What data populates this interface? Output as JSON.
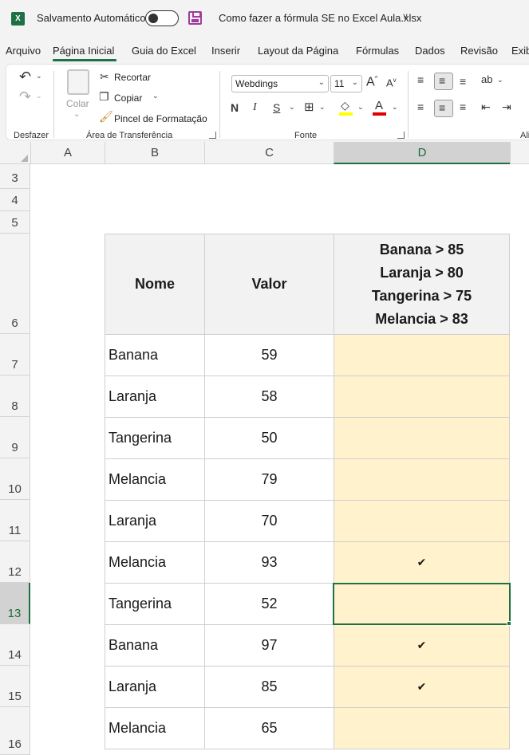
{
  "titlebar": {
    "app_logo": "X",
    "autosave_label": "Salvamento Automático",
    "doc_title": "Como fazer a fórmula SE no Excel Aula.xlsx",
    "dropdown_glyph": "∨"
  },
  "tabs": [
    "Arquivo",
    "Página Inicial",
    "Guia do Excel",
    "Inserir",
    "Layout da Página",
    "Fórmulas",
    "Dados",
    "Revisão",
    "Exib"
  ],
  "ribbon": {
    "undo_group_label": "Desfazer",
    "clipboard": {
      "paste_label": "Colar",
      "cut_label": "Recortar",
      "copy_label": "Copiar",
      "format_painter_label": "Pincel de Formatação",
      "group_label": "Área de Transferência"
    },
    "font": {
      "font_name": "Webdings",
      "font_size": "11",
      "bold": "N",
      "italic": "I",
      "underline": "S",
      "grow": "A",
      "shrink": "A",
      "font_color_letter": "A",
      "group_label": "Fonte"
    },
    "alignment": {
      "group_label": "Ali"
    }
  },
  "columns": [
    "A",
    "B",
    "C",
    "D"
  ],
  "rows": [
    "3",
    "4",
    "5",
    "6",
    "7",
    "8",
    "9",
    "10",
    "11",
    "12",
    "13",
    "14",
    "15",
    "16"
  ],
  "selected": {
    "column": "D",
    "row": "13"
  },
  "table": {
    "header_nome": "Nome",
    "header_valor": "Valor",
    "criteria": [
      "Banana > 85",
      "Laranja > 80",
      "Tangerina > 75",
      "Melancia > 83"
    ],
    "rows": [
      {
        "nome": "Banana",
        "valor": "59",
        "resultado": ""
      },
      {
        "nome": "Laranja",
        "valor": "58",
        "resultado": ""
      },
      {
        "nome": "Tangerina",
        "valor": "50",
        "resultado": ""
      },
      {
        "nome": "Melancia",
        "valor": "79",
        "resultado": ""
      },
      {
        "nome": "Laranja",
        "valor": "70",
        "resultado": ""
      },
      {
        "nome": "Melancia",
        "valor": "93",
        "resultado": "✔"
      },
      {
        "nome": "Tangerina",
        "valor": "52",
        "resultado": ""
      },
      {
        "nome": "Banana",
        "valor": "97",
        "resultado": "✔"
      },
      {
        "nome": "Laranja",
        "valor": "85",
        "resultado": "✔"
      },
      {
        "nome": "Melancia",
        "valor": "65",
        "resultado": ""
      }
    ]
  },
  "colors": {
    "accent": "#1e7145",
    "result_fill": "#fff2cc",
    "header_fill": "#f2f2f2"
  }
}
